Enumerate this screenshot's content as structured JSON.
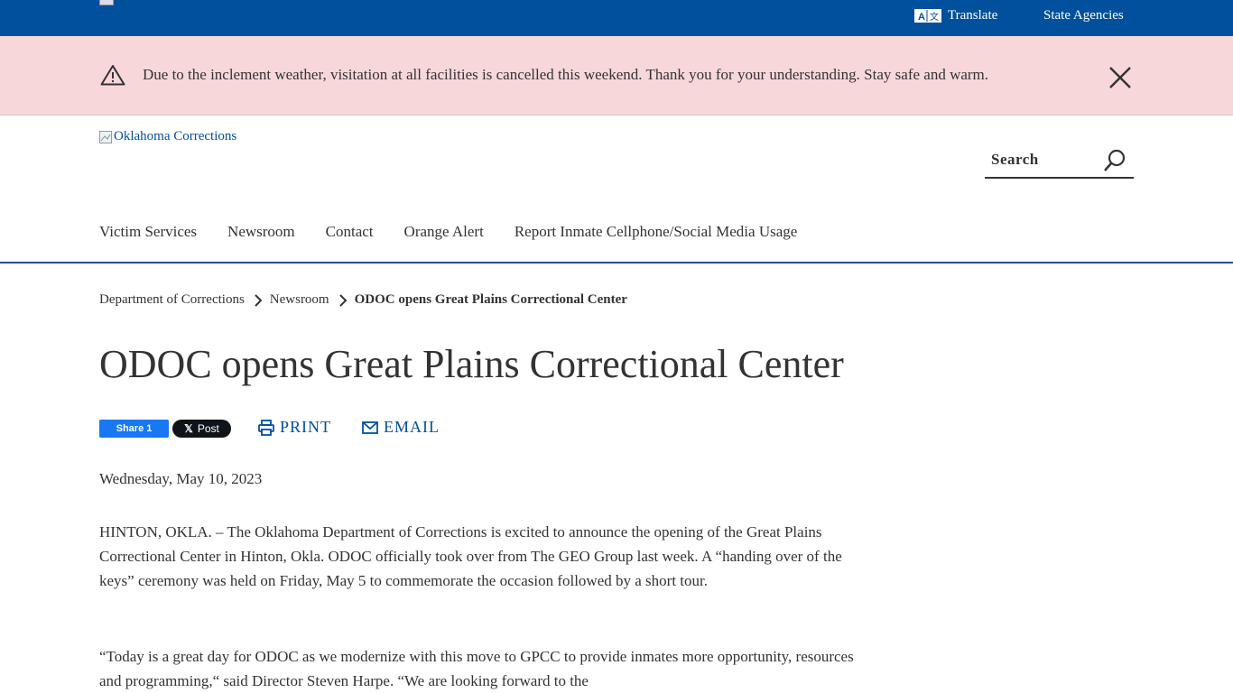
{
  "topbar": {
    "translate_label": "Translate",
    "agencies_label": "State Agencies",
    "brand_color": "#00509e"
  },
  "alert": {
    "message": "Due to the inclement weather, visitation at all facilities is cancelled this weekend. Thank you for your understanding. Stay safe and warm.",
    "background": "#f8d7da"
  },
  "header": {
    "logo_alt": "Oklahoma Corrections",
    "search_label": "Search"
  },
  "nav": {
    "items": [
      "Victim Services",
      "Newsroom",
      "Contact",
      "Orange Alert",
      "Report Inmate Cellphone/Social Media Usage"
    ]
  },
  "breadcrumb": {
    "items": [
      "Department of Corrections",
      "Newsroom",
      "ODOC opens Great Plains Correctional Center"
    ]
  },
  "article": {
    "title": "ODOC opens Great Plains Correctional Center",
    "share_label": "Share 1",
    "post_label": "Post",
    "print_label": "PRINT",
    "email_label": "EMAIL",
    "date": "Wednesday, May 10, 2023",
    "paragraphs": [
      "HINTON, OKLA. – The Oklahoma Department of Corrections is excited to announce the opening of the Great Plains Correctional Center in Hinton, Okla. ODOC officially took over from The GEO Group last week. A “handing over of the keys” ceremony was held on Friday, May 5 to commemorate the occasion followed by a short tour.",
      "“Today is a great day for ODOC as we modernize with this move to GPCC to provide inmates more opportunity, resources and programming,“ said Director Steven Harpe. “We are looking forward to the"
    ]
  }
}
